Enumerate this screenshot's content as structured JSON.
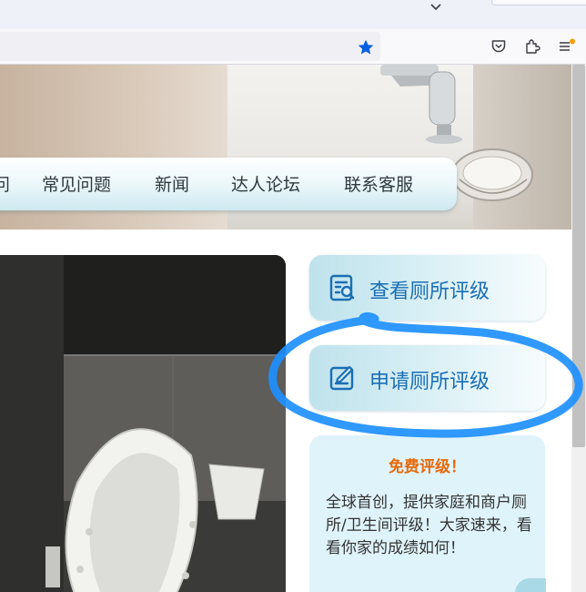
{
  "browser": {
    "icons": [
      "chevron-down-icon",
      "star-icon",
      "pocket-icon",
      "extensions-icon",
      "menu-icon"
    ],
    "accent": "#0060df"
  },
  "nav": {
    "items": [
      "问",
      "常见问题",
      "新闻",
      "达人论坛",
      "联系客服"
    ]
  },
  "sidebar": {
    "view_rating": "查看厕所评级",
    "apply_rating": "申请厕所评级"
  },
  "promo": {
    "title": "免费评级！",
    "body": "全球首创，提供家庭和商户厕所/卫生间评级！大家速来，看看你家的成绩如何！"
  },
  "colors": {
    "link_blue": "#1a6fb5",
    "promo_orange": "#e66a0a",
    "annotation_blue": "#1e90ff"
  }
}
